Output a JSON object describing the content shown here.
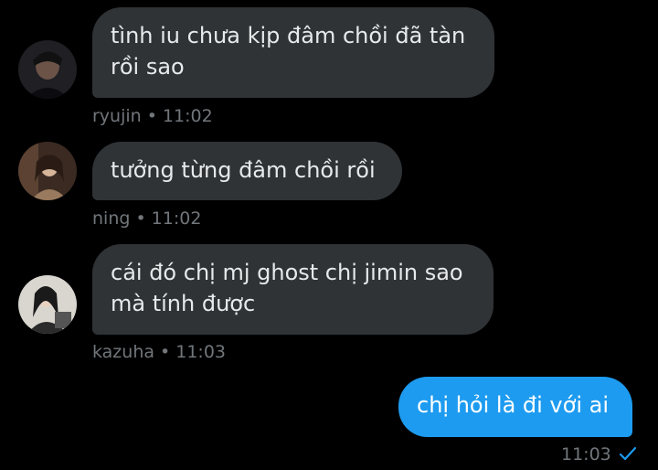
{
  "messages": [
    {
      "text": "tình iu chưa kịp đâm chồi đã tàn rồi sao",
      "sender": "ryujin",
      "separator": "•",
      "time": "11:02"
    },
    {
      "text": "tưởng từng đâm chồi rồi",
      "sender": "ning",
      "separator": "•",
      "time": "11:02"
    },
    {
      "text": "cái đó chị mj ghost chị jimin sao mà tính được",
      "sender": "kazuha",
      "separator": "•",
      "time": "11:03"
    },
    {
      "text": "chị hỏi là đi với ai",
      "time": "11:03",
      "status_icon": "sent-check-icon"
    }
  ],
  "colors": {
    "background": "#000000",
    "incoming_bubble": "#2f3336",
    "outgoing_bubble": "#1d9bf0",
    "meta_text": "#71767b",
    "check": "#1d9bf0"
  }
}
